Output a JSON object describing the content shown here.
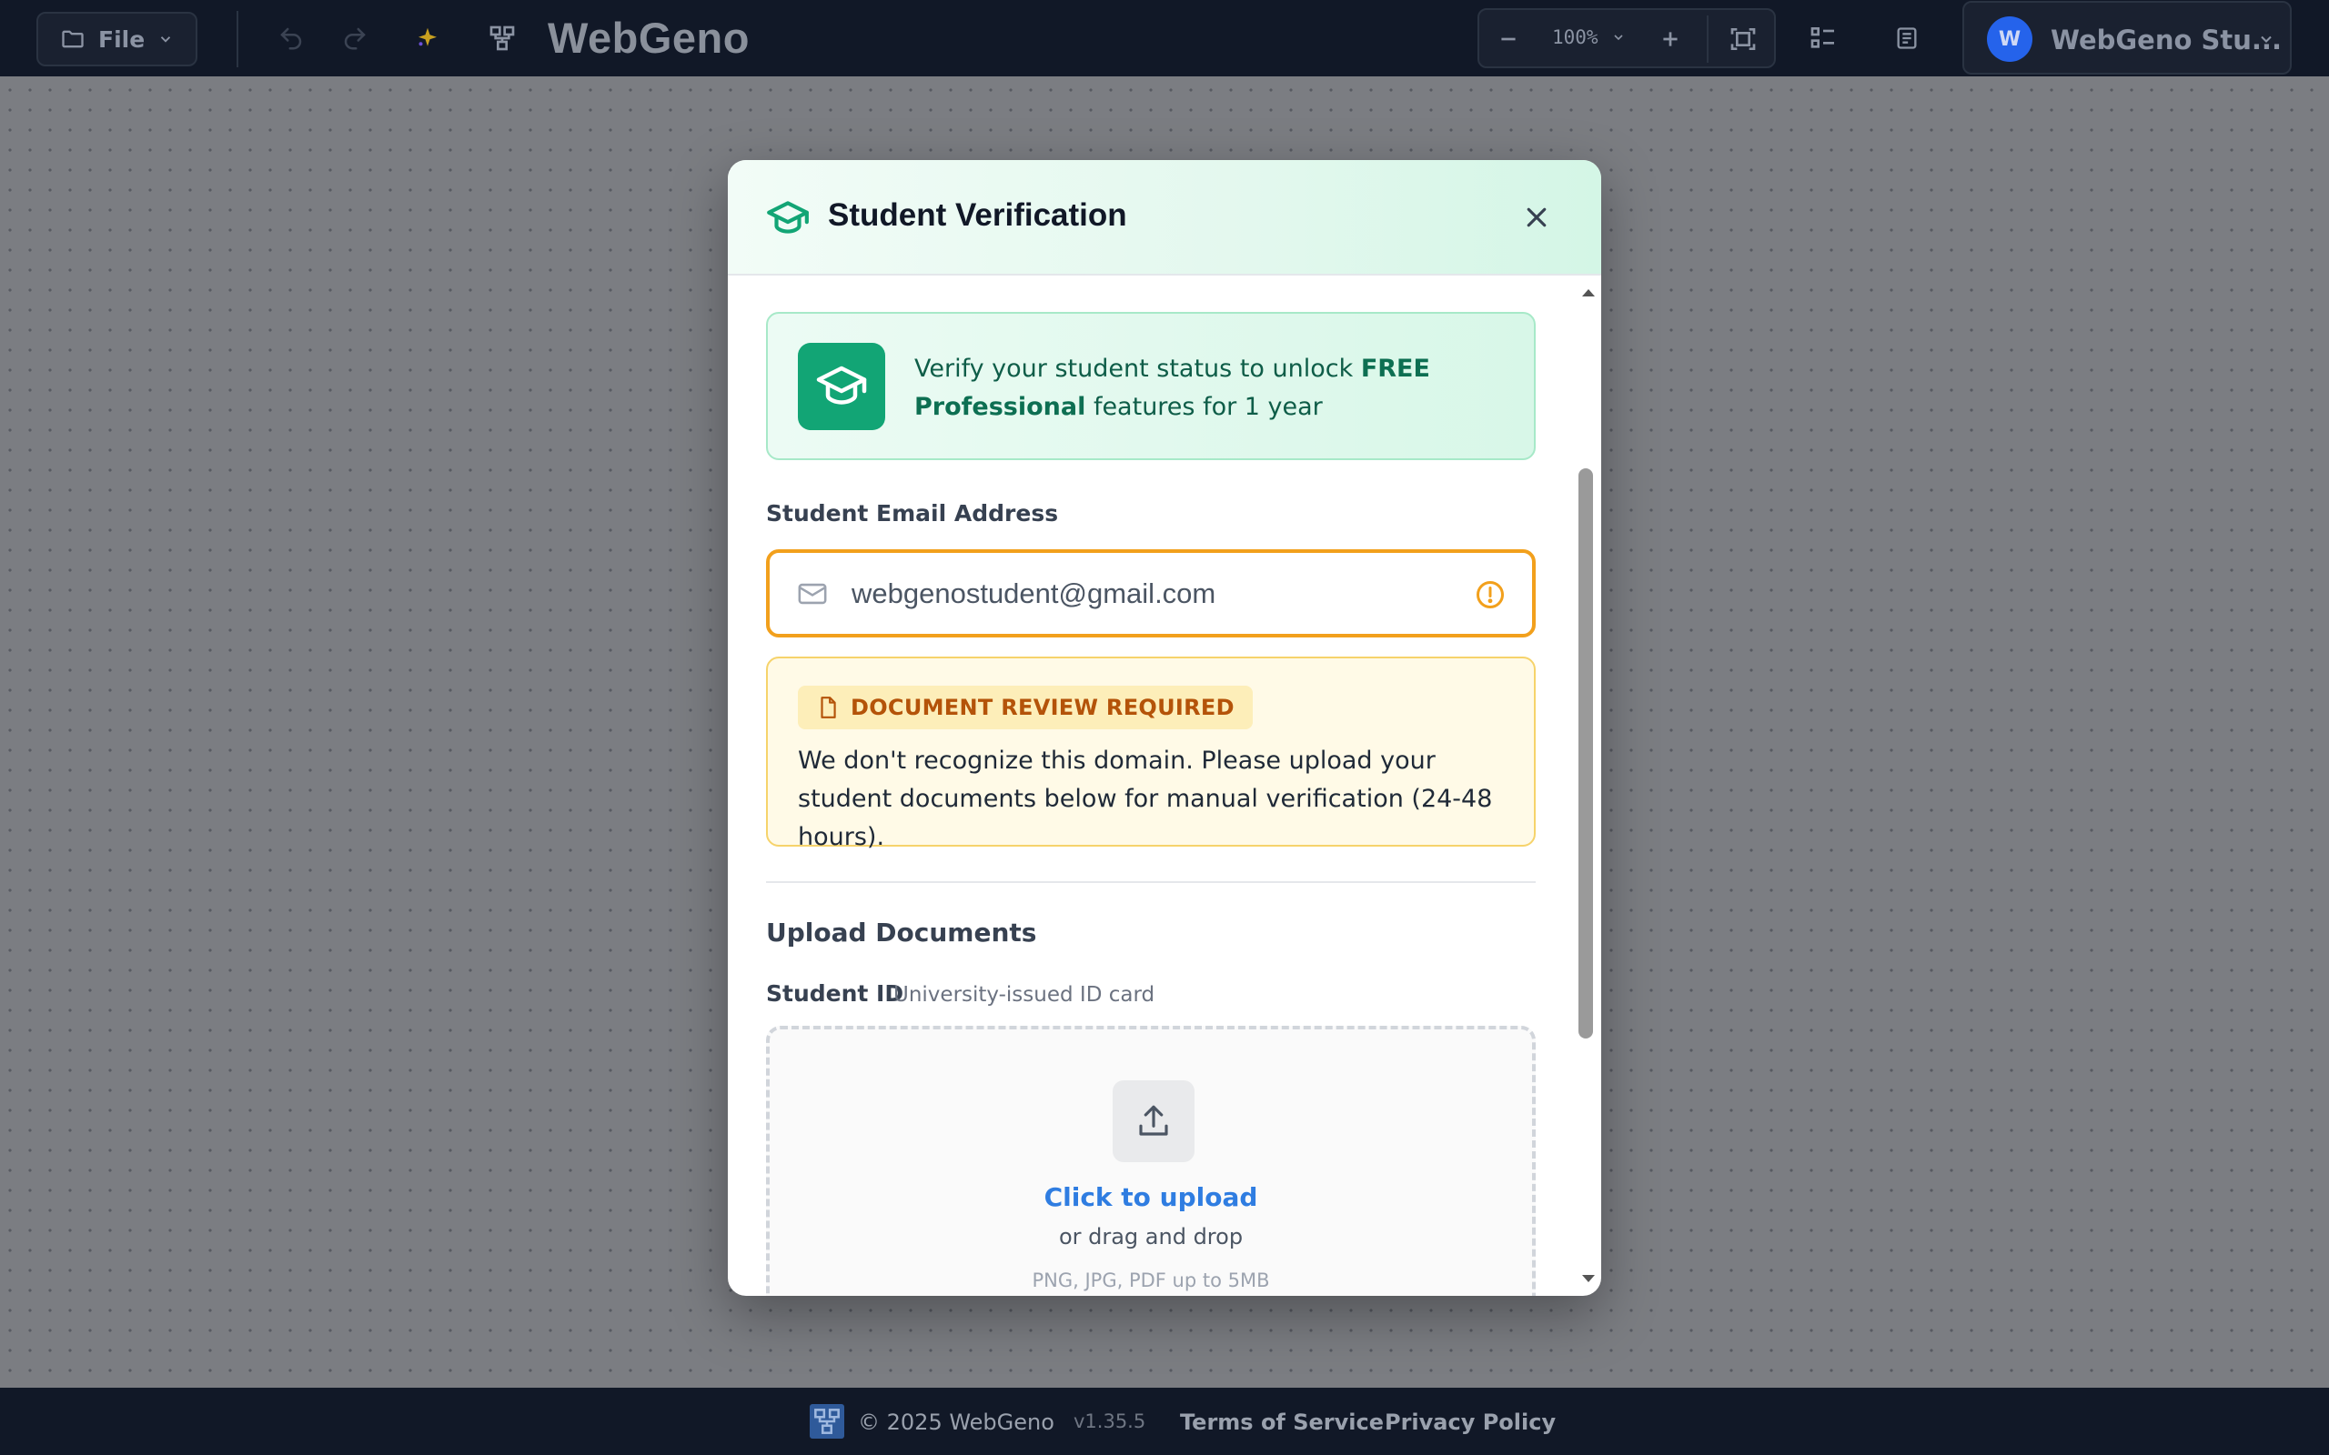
{
  "toolbar": {
    "file_label": "File",
    "brand": "WebGeno",
    "zoom_level": "100%",
    "account_initial": "W",
    "account_name": "WebGeno Stu..."
  },
  "modal": {
    "title": "Student Verification",
    "promo": {
      "text_before": "Verify your student status to unlock ",
      "highlight": "FREE Professional",
      "text_after": " features for 1 year"
    },
    "email": {
      "label": "Student Email Address",
      "value": "webgenostudent@gmail.com"
    },
    "review": {
      "badge": "DOCUMENT REVIEW REQUIRED",
      "message": "We don't recognize this domain. Please upload your student documents below for manual verification (24-48 hours)."
    },
    "upload_section": {
      "title": "Upload Documents",
      "student_id_label": "Student ID",
      "student_id_hint": "University-issued ID card",
      "cta": "Click to upload",
      "sub": "or drag and drop",
      "types": "PNG, JPG, PDF up to 5MB"
    }
  },
  "footer": {
    "copyright": "© 2025 WebGeno",
    "version": "v1.35.5",
    "terms": "Terms of Service",
    "privacy": "Privacy Policy"
  },
  "colors": {
    "toolbar_bg": "#111827",
    "accent_green": "#12a575",
    "warning_amber": "#f2a01c",
    "link_blue": "#2f7de1",
    "avatar_blue": "#2563eb"
  },
  "icons": [
    "folder-icon",
    "chevron-down-icon",
    "undo-icon",
    "redo-icon",
    "sparkle-icon",
    "diagram-icon",
    "minus-icon",
    "plus-icon",
    "fit-screen-icon",
    "list-icon",
    "document-icon",
    "graduation-cap-icon",
    "close-icon",
    "mail-icon",
    "warning-circle-icon",
    "file-icon",
    "upload-icon"
  ]
}
